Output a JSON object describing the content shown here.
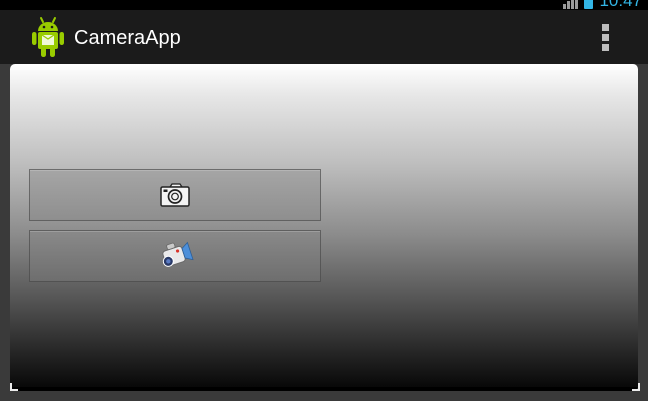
{
  "status_bar": {
    "time": "10:47",
    "signal_icon": "signal-icon",
    "battery_icon": "battery-icon",
    "accent_color": "#33b5e5"
  },
  "action_bar": {
    "title": "CameraApp",
    "app_icon": "android-robot-icon",
    "menu_icon": "overflow-menu-icon"
  },
  "content": {
    "buttons": [
      {
        "icon": "camera-icon",
        "action": "take-photo"
      },
      {
        "icon": "video-camera-icon",
        "action": "record-video"
      }
    ]
  }
}
